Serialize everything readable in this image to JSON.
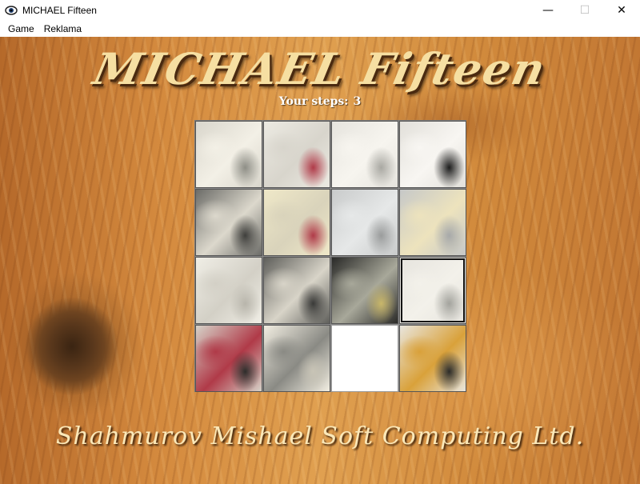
{
  "window": {
    "title": "MICHAEL Fifteen",
    "minimize_symbol": "—",
    "maximize_symbol": "☐",
    "close_symbol": "✕"
  },
  "menu": {
    "items": [
      "Game",
      "Reklama"
    ]
  },
  "game": {
    "title": "MICHAEL Fifteen",
    "steps_label": "Your steps:",
    "steps_value": "3",
    "footer": "Shahmurov Mishael Soft Computing Ltd.",
    "grid_size": 4,
    "empty_position": {
      "row": 4,
      "col": 3
    },
    "selected_position": {
      "row": 3,
      "col": 4
    },
    "tiles": [
      {
        "row": 1,
        "col": 1,
        "image": "calla-lily-glass",
        "colors": [
          "#d9d6cc",
          "#f3f0e6",
          "#8e8e86"
        ]
      },
      {
        "row": 1,
        "col": 2,
        "image": "ribbon-bubbles",
        "colors": [
          "#eceae2",
          "#d8d5cc",
          "#b03a48"
        ]
      },
      {
        "row": 1,
        "col": 3,
        "image": "glass-rim-flower",
        "colors": [
          "#e6e4de",
          "#f7f5ef",
          "#a9a8a2"
        ]
      },
      {
        "row": 1,
        "col": 4,
        "image": "bottle-neck-pleats",
        "colors": [
          "#e2e0da",
          "#f8f6f2",
          "#1c1c1c"
        ]
      },
      {
        "row": 2,
        "col": 1,
        "image": "dark-calla",
        "colors": [
          "#6c6c68",
          "#dcd8cc",
          "#3f3f3c"
        ]
      },
      {
        "row": 2,
        "col": 2,
        "image": "champagne-pour",
        "colors": [
          "#efe8c8",
          "#d9d3bb",
          "#b03a48"
        ]
      },
      {
        "row": 2,
        "col": 3,
        "image": "glass-clear",
        "colors": [
          "#c9cbcb",
          "#e6e8e8",
          "#9a9c9c"
        ]
      },
      {
        "row": 2,
        "col": 4,
        "image": "glass-bubbles-gray",
        "colors": [
          "#c6c8c8",
          "#ede3bd",
          "#a7a9a9"
        ]
      },
      {
        "row": 3,
        "col": 1,
        "image": "white-pleats",
        "colors": [
          "#f0eee6",
          "#d3d0c6",
          "#b8b5ab"
        ]
      },
      {
        "row": 3,
        "col": 2,
        "image": "calla-shadow",
        "colors": [
          "#5f5f5b",
          "#d8d4c8",
          "#3a3a38"
        ]
      },
      {
        "row": 3,
        "col": 3,
        "image": "bottle-label",
        "colors": [
          "#2a2a28",
          "#a8a89a",
          "#c9b76a"
        ]
      },
      {
        "row": 3,
        "col": 4,
        "image": "glass-foam",
        "colors": [
          "#e6e4de",
          "#f3f1ea",
          "#a3a39d"
        ]
      },
      {
        "row": 4,
        "col": 1,
        "image": "ribbon-bottle",
        "colors": [
          "#d6d3c9",
          "#b03a48",
          "#2d2d2b"
        ]
      },
      {
        "row": 4,
        "col": 2,
        "image": "calla-bloom",
        "colors": [
          "#f2eee2",
          "#8a8a84",
          "#c8c4b6"
        ]
      },
      {
        "row": 4,
        "col": 4,
        "image": "champagne-glass-gold",
        "colors": [
          "#e9e6de",
          "#d9a13a",
          "#2b2b29"
        ]
      }
    ]
  }
}
